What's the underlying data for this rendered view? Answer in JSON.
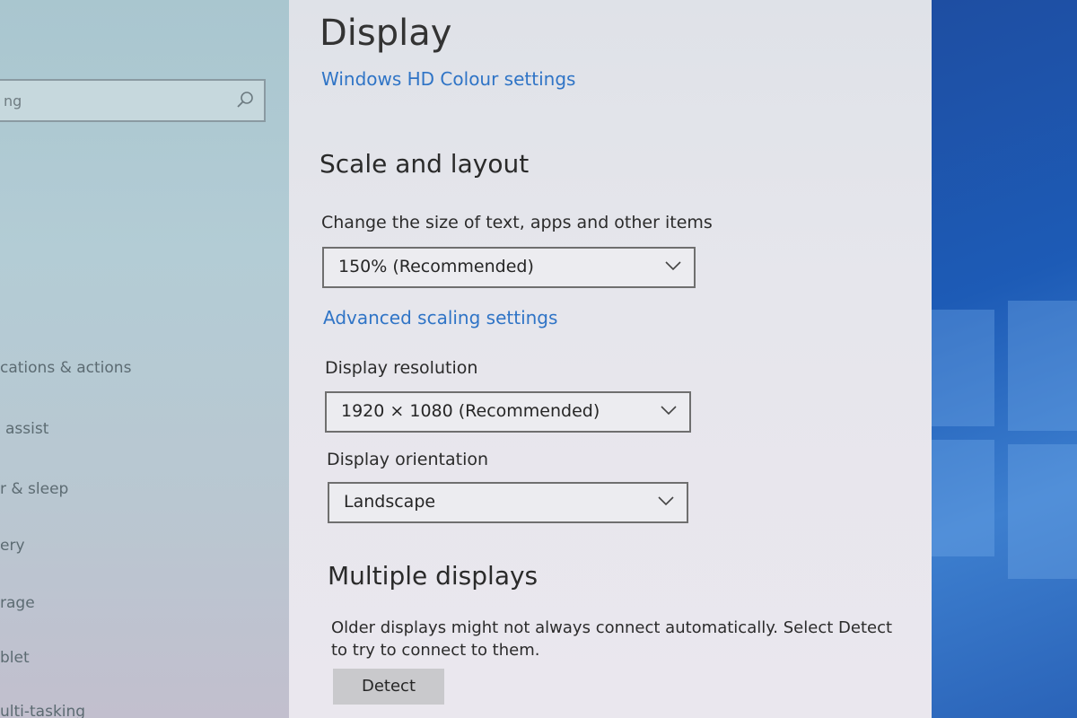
{
  "sidebar": {
    "search_text": "ng",
    "items": [
      {
        "label": "cations & actions"
      },
      {
        "label": "assist"
      },
      {
        "label": "r & sleep"
      },
      {
        "label": "ery"
      },
      {
        "label": "rage"
      },
      {
        "label": "blet"
      },
      {
        "label": "ulti-tasking"
      }
    ]
  },
  "main": {
    "title": "Display",
    "hd_colour_link": "Windows HD Colour settings",
    "scale_section": {
      "title": "Scale and layout",
      "size_label": "Change the size of text, apps and other items",
      "size_value": "150% (Recommended)",
      "advanced_link": "Advanced scaling settings",
      "resolution_label": "Display resolution",
      "resolution_value": "1920 × 1080 (Recommended)",
      "orientation_label": "Display orientation",
      "orientation_value": "Landscape"
    },
    "multiple_section": {
      "title": "Multiple displays",
      "description_line1": "Older displays might not always connect automatically. Select Detect",
      "description_line2": "to try to connect to them.",
      "detect_button": "Detect"
    }
  },
  "colors": {
    "accent_link": "#2f74c6",
    "wallpaper": "#1d5bb6"
  }
}
